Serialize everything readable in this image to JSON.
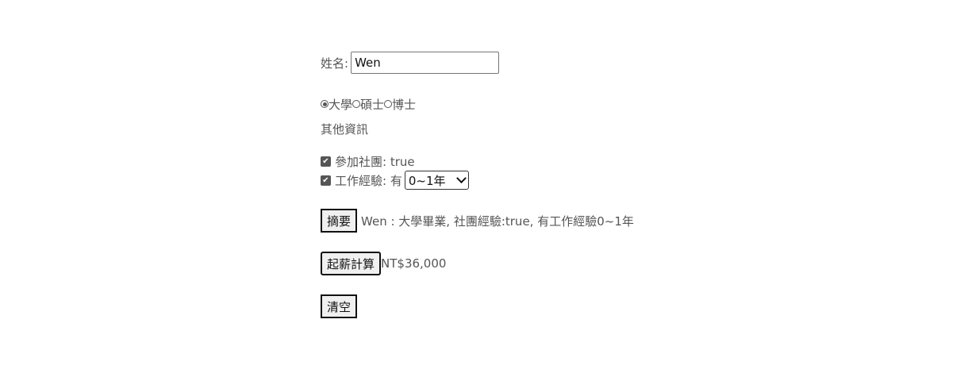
{
  "name_field": {
    "label": "姓名:",
    "value": "Wen"
  },
  "education": {
    "options": [
      {
        "label": "大學",
        "checked": true
      },
      {
        "label": "碩士",
        "checked": false
      },
      {
        "label": "博士",
        "checked": false
      }
    ]
  },
  "other_info": {
    "heading": "其他資訊"
  },
  "club": {
    "label": "參加社團: true",
    "checked": true
  },
  "work": {
    "label": "工作經驗: 有",
    "checked": true,
    "select_value": "0~1年"
  },
  "summary": {
    "button_label": "摘要",
    "result_text": "Wen : 大學畢業, 社團經驗:true, 有工作經驗0~1年"
  },
  "salary": {
    "button_label": "起薪計算",
    "result_text": "NT$36,000"
  },
  "clear": {
    "button_label": "清空"
  },
  "icons": {
    "checkbox": "checkmark-icon",
    "select": "chevron-down-icon"
  }
}
